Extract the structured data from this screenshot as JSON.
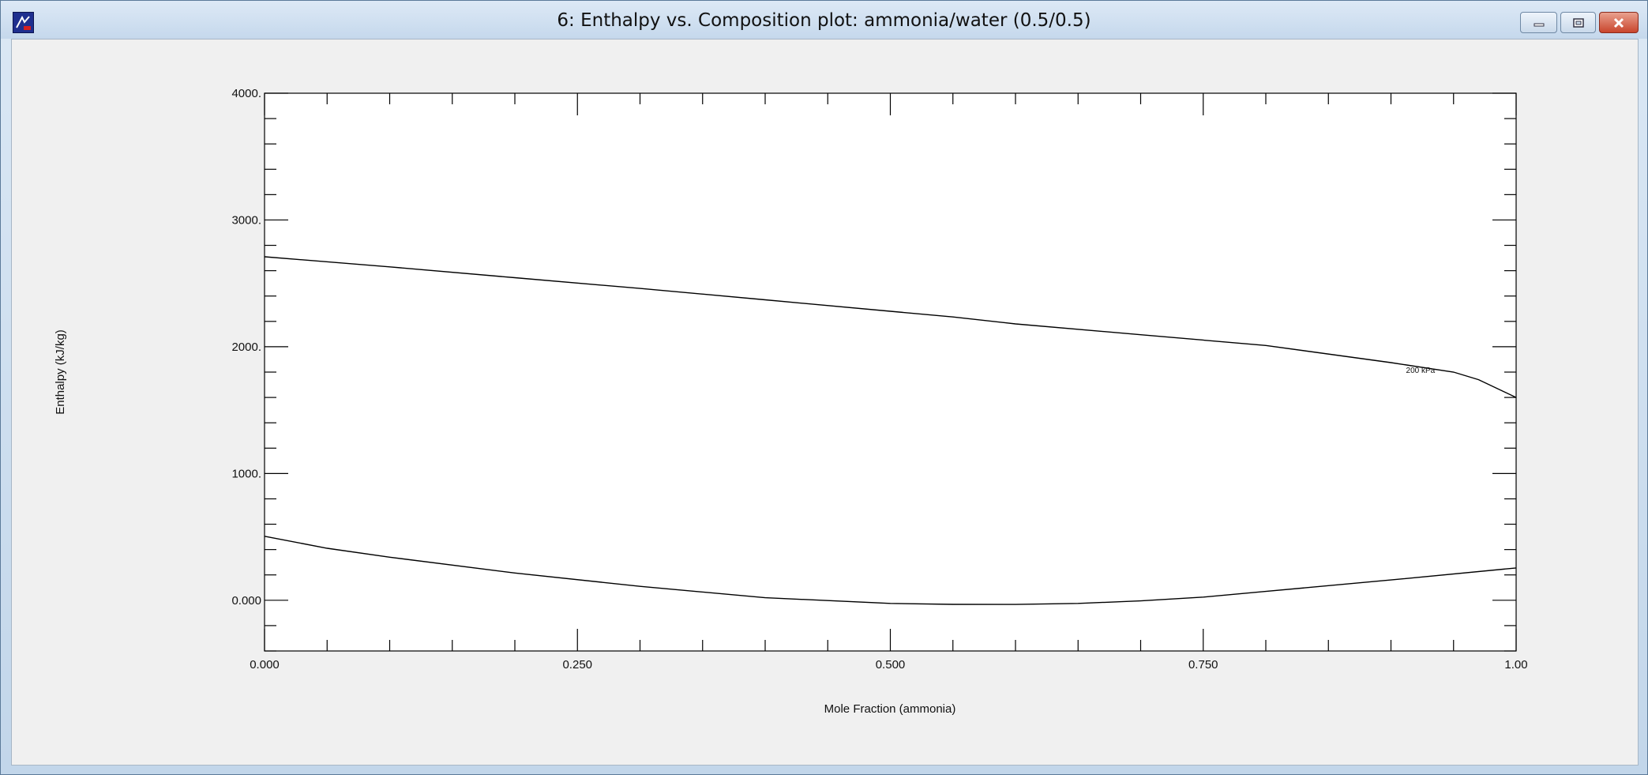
{
  "window": {
    "title": "6: Enthalpy vs. Composition plot: ammonia/water (0.5/0.5)",
    "app_icon": "app-logo-icon",
    "controls": {
      "minimize_icon": "minimize-icon",
      "maximize_icon": "maximize-icon",
      "close_icon": "close-icon"
    }
  },
  "colors": {
    "client_bg": "#f0f0f0",
    "plot_bg": "#ffffff",
    "line": "#000000",
    "close_button": "#c9452c"
  },
  "chart_data": {
    "type": "line",
    "title": "",
    "xlabel": "Mole Fraction (ammonia)",
    "ylabel": "Enthalpy (kJ/kg)",
    "xlim": [
      0,
      1
    ],
    "ylim": [
      -400,
      4000
    ],
    "x_ticks": [
      {
        "value": 0,
        "label": "0.000"
      },
      {
        "value": 0.25,
        "label": "0.250"
      },
      {
        "value": 0.5,
        "label": "0.500"
      },
      {
        "value": 0.75,
        "label": "0.750"
      },
      {
        "value": 1,
        "label": "1.00"
      }
    ],
    "y_ticks": [
      {
        "value": 0,
        "label": "0.000"
      },
      {
        "value": 1000,
        "label": "1000."
      },
      {
        "value": 2000,
        "label": "2000."
      },
      {
        "value": 3000,
        "label": "3000."
      },
      {
        "value": 4000,
        "label": "4000."
      }
    ],
    "grid": false,
    "series": [
      {
        "points": [
          [
            0,
            2710
          ],
          [
            0.1,
            2630
          ],
          [
            0.2,
            2545
          ],
          [
            0.3,
            2460
          ],
          [
            0.4,
            2370
          ],
          [
            0.5,
            2280
          ],
          [
            0.55,
            2235
          ],
          [
            0.6,
            2180
          ],
          [
            0.7,
            2095
          ],
          [
            0.8,
            2010
          ],
          [
            0.9,
            1875
          ],
          [
            0.95,
            1800
          ],
          [
            0.97,
            1740
          ],
          [
            1.0,
            1600
          ]
        ]
      },
      {
        "points": [
          [
            0,
            505
          ],
          [
            0.05,
            410
          ],
          [
            0.1,
            340
          ],
          [
            0.2,
            215
          ],
          [
            0.3,
            110
          ],
          [
            0.4,
            20
          ],
          [
            0.5,
            -25
          ],
          [
            0.55,
            -32
          ],
          [
            0.6,
            -33
          ],
          [
            0.65,
            -25
          ],
          [
            0.7,
            -5
          ],
          [
            0.75,
            25
          ],
          [
            0.8,
            70
          ],
          [
            0.9,
            160
          ],
          [
            1.0,
            255
          ]
        ]
      }
    ],
    "annotations": [
      {
        "text": "200 kPa",
        "x": 0.912,
        "y": 1820
      }
    ]
  }
}
